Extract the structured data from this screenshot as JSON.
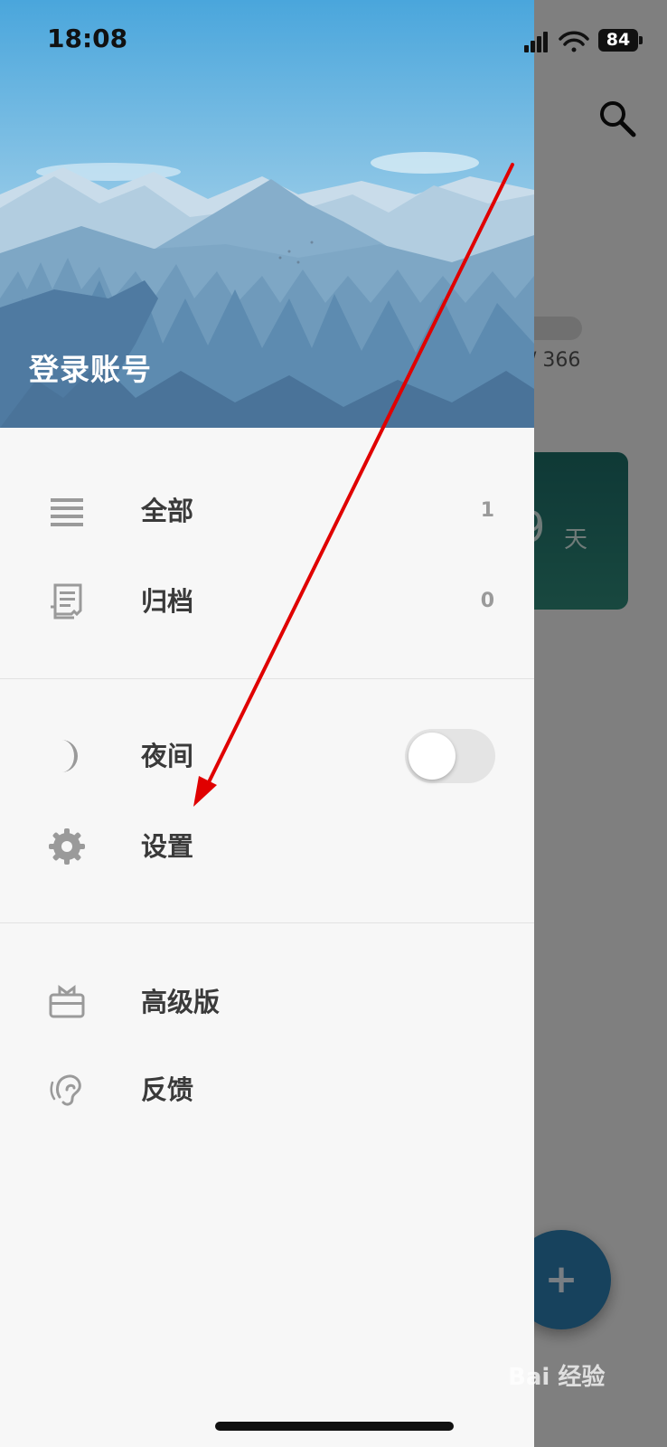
{
  "status_bar": {
    "time": "18:08",
    "battery": "84"
  },
  "header": {
    "login_label": "登录账号"
  },
  "menu": {
    "all": {
      "label": "全部",
      "count": "1",
      "icon": "list-icon"
    },
    "archive": {
      "label": "归档",
      "count": "0",
      "icon": "receipt-icon"
    },
    "night": {
      "label": "夜间",
      "icon": "moon-icon",
      "enabled": false
    },
    "settings": {
      "label": "设置",
      "icon": "gear-icon"
    },
    "premium": {
      "label": "高级版",
      "icon": "gift-icon"
    },
    "feedback": {
      "label": "反馈",
      "icon": "ear-icon"
    }
  },
  "background": {
    "progress_text": "/ 366",
    "card_number": "9",
    "card_unit": "天",
    "fab_label": "+"
  },
  "watermark": "Bai 经验",
  "colors": {
    "accent": "#2d7fb3",
    "card": "#1d6d68",
    "arrow": "#e00000"
  }
}
